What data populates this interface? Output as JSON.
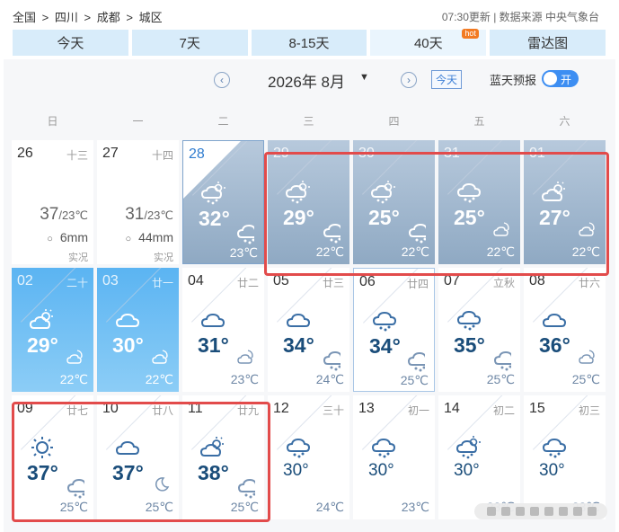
{
  "breadcrumb": [
    "全国",
    ">",
    "四川",
    ">",
    "成都",
    ">",
    "城区"
  ],
  "meta": "07:30更新 | 数据来源 中央气象台",
  "tabs": [
    {
      "label": "今天"
    },
    {
      "label": "7天"
    },
    {
      "label": "8-15天"
    },
    {
      "label": "40天",
      "badge": "hot"
    },
    {
      "label": "雷达图"
    }
  ],
  "month_label": "2026年  8月",
  "today_button": "今天",
  "clear_sky_label": "蓝天预报",
  "toggle_label": "开",
  "weekdays": [
    "日",
    "一",
    "二",
    "三",
    "四",
    "五",
    "六"
  ],
  "days": [
    {
      "day": "26",
      "lunar": "十三",
      "type": "past",
      "hi": "37",
      "lo": "/23℃",
      "rain": "6mm",
      "tag": "实况"
    },
    {
      "day": "27",
      "lunar": "十四",
      "type": "past",
      "hi": "31",
      "lo": "/23℃",
      "rain": "44mm",
      "tag": "实况"
    },
    {
      "day": "28",
      "lunar": "",
      "type": "today",
      "hi": "32°",
      "lo": "23℃",
      "icon": "partly-cloudy-rain-icon",
      "night": "cloud-rain-icon"
    },
    {
      "day": "29",
      "lunar": "",
      "type": "grey",
      "hi": "29°",
      "lo": "22℃",
      "icon": "partly-cloudy-rain-icon",
      "night": "cloud-rain-icon"
    },
    {
      "day": "30",
      "lunar": "",
      "type": "grey",
      "hi": "25°",
      "lo": "22℃",
      "icon": "partly-cloudy-rain-icon",
      "night": "cloud-rain-icon"
    },
    {
      "day": "31",
      "lunar": "",
      "type": "grey",
      "hi": "25°",
      "lo": "22℃",
      "icon": "cloud-rain-icon",
      "night": "moon-cloud-icon"
    },
    {
      "day": "01",
      "lunar": "",
      "type": "grey",
      "hi": "27°",
      "lo": "22℃",
      "icon": "partly-cloudy-icon",
      "night": "moon-cloud-icon"
    },
    {
      "day": "02",
      "lunar": "二十",
      "type": "blue",
      "hi": "29°",
      "lo": "22℃",
      "icon": "partly-cloudy-icon",
      "night": "moon-cloud-icon"
    },
    {
      "day": "03",
      "lunar": "廿一",
      "type": "blue",
      "hi": "30°",
      "lo": "22℃",
      "icon": "cloudy-icon",
      "night": "moon-cloud-icon"
    },
    {
      "day": "04",
      "lunar": "廿二",
      "type": "normal",
      "hi": "31°",
      "lo": "23℃",
      "icon": "cloudy-icon",
      "night": "moon-cloud-icon"
    },
    {
      "day": "05",
      "lunar": "廿三",
      "type": "normal",
      "hi": "34°",
      "lo": "24℃",
      "icon": "cloudy-icon",
      "night": "cloud-rain-icon"
    },
    {
      "day": "06",
      "lunar": "廿四",
      "type": "outline",
      "hi": "34°",
      "lo": "25℃",
      "icon": "cloud-rain-icon",
      "night": "cloud-rain-icon"
    },
    {
      "day": "07",
      "lunar": "立秋",
      "type": "normal",
      "hi": "35°",
      "lo": "25℃",
      "icon": "cloud-rain-icon",
      "night": "cloud-rain-icon"
    },
    {
      "day": "08",
      "lunar": "廿六",
      "type": "normal",
      "hi": "36°",
      "lo": "25℃",
      "icon": "cloudy-icon",
      "night": "moon-cloud-icon"
    },
    {
      "day": "09",
      "lunar": "廿七",
      "type": "normal",
      "hi": "37°",
      "lo": "25℃",
      "icon": "sun-icon",
      "night": "cloud-rain-icon"
    },
    {
      "day": "10",
      "lunar": "廿八",
      "type": "normal",
      "hi": "37°",
      "lo": "25℃",
      "icon": "cloudy-icon",
      "night": "moon-icon"
    },
    {
      "day": "11",
      "lunar": "廿九",
      "type": "normal",
      "hi": "38°",
      "lo": "25℃",
      "icon": "partly-cloudy-icon",
      "night": "cloud-rain-icon"
    },
    {
      "day": "12",
      "lunar": "三十",
      "type": "normal",
      "hi": "30°",
      "lo": "24℃",
      "icon": "cloud-rain-icon",
      "small": true
    },
    {
      "day": "13",
      "lunar": "初一",
      "type": "normal",
      "hi": "30°",
      "lo": "23℃",
      "icon": "cloud-rain-icon",
      "small": true
    },
    {
      "day": "14",
      "lunar": "初二",
      "type": "normal",
      "hi": "30°",
      "lo": "23℃",
      "icon": "partly-cloudy-rain-icon",
      "small": true
    },
    {
      "day": "15",
      "lunar": "初三",
      "type": "normal",
      "hi": "30°",
      "lo": "23℃",
      "icon": "cloud-rain-icon",
      "small": true
    }
  ],
  "colors": {
    "accent": "#3d8ef2",
    "highlight_box": "#e24b4b",
    "temp_text": "#1a4d7a"
  }
}
